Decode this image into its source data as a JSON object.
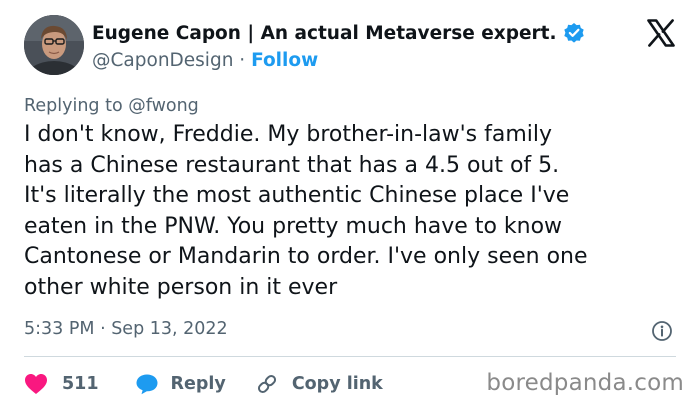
{
  "author": {
    "display_name": "Eugene Capon | An actual Metaverse expert.",
    "handle": "@CaponDesign",
    "separator": " · ",
    "follow_label": "Follow",
    "verified": true
  },
  "reply_context": "Replying to @fwong",
  "tweet": {
    "lines": [
      "I don't know, Freddie. My brother-in-law's family",
      "has a Chinese restaurant that has a 4.5 out of 5.",
      "It's literally the most authentic Chinese place I've",
      "eaten in the PNW. You pretty much have to know",
      "Cantonese or Mandarin to order. I've only seen one",
      "other white person in it ever"
    ],
    "timestamp": "5:33 PM · Sep 13, 2022"
  },
  "actions": {
    "like_count": "511",
    "reply_label": "Reply",
    "copy_link_label": "Copy link"
  },
  "icons": {
    "verified": "verified-badge-icon",
    "x_logo": "x-logo-icon",
    "info": "info-icon",
    "like": "heart-icon",
    "reply": "speech-bubble-icon",
    "copy_link": "link-icon"
  },
  "colors": {
    "text": "#0f1419",
    "secondary": "#536471",
    "accent": "#1d9bf0",
    "like": "#f91880"
  },
  "watermark": "boredpanda.com"
}
